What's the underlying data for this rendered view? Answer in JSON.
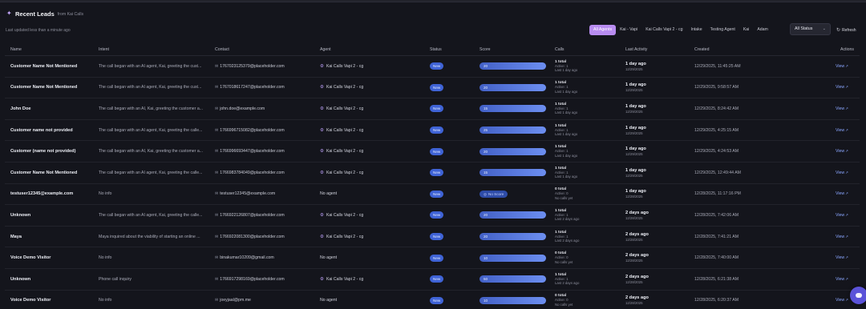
{
  "header": {
    "title": "Recent Leads",
    "subtitle": "from Kai Calls",
    "updated": "Last updated less than a minute ago"
  },
  "filters": {
    "agents": [
      "All Agents",
      "Kai - Vapi",
      "Kai Calls Vapi 2 - cg",
      "Intake",
      "Testing Agent",
      "Kai",
      "Adam"
    ],
    "active_agent_index": 0,
    "status_value": "All Status",
    "refresh_label": "Refresh"
  },
  "table": {
    "columns": [
      "Name",
      "Intent",
      "Contact",
      "Agent",
      "Status",
      "Score",
      "Calls",
      "Last Activity",
      "Created",
      "Actions"
    ],
    "rows": [
      {
        "name": "Customer Name Not Mentioned",
        "intent": "The call began with an AI agent, Kai, greeting the cust...",
        "contact": "1767023125379@placeholder.com",
        "agent": "Kai Calls Vapi 2 - cg",
        "has_agent": true,
        "status": "New",
        "score": "20",
        "score_text": "",
        "calls_total": "1 total",
        "calls_active": "Active: 1",
        "calls_last": "Last 1 day ago",
        "activity": "1 day ago",
        "activity_date": "12/29/2025",
        "created": "12/29/2025, 11:45:25 AM",
        "action": "View"
      },
      {
        "name": "Customer Name Not Mentioned",
        "intent": "The call began with an AI agent, Kai, greeting the cust...",
        "contact": "1767018617247@placeholder.com",
        "agent": "Kai Calls Vapi 2 - cg",
        "has_agent": true,
        "status": "New",
        "score": "20",
        "score_text": "",
        "calls_total": "1 total",
        "calls_active": "Active: 1",
        "calls_last": "Last 1 day ago",
        "activity": "1 day ago",
        "activity_date": "12/29/2025",
        "created": "12/29/2025, 9:58:57 AM",
        "action": "View"
      },
      {
        "name": "John Doe",
        "intent": "The call began with an AI, Kai, greeting the customer a...",
        "contact": "john.doe@example.com",
        "agent": "Kai Calls Vapi 2 - cg",
        "has_agent": true,
        "status": "New",
        "score": "15",
        "score_text": "",
        "calls_total": "1 total",
        "calls_active": "Active: 1",
        "calls_last": "Last 1 day ago",
        "activity": "1 day ago",
        "activity_date": "12/29/2025",
        "created": "12/29/2025, 8:24:42 AM",
        "action": "View"
      },
      {
        "name": "Customer name not provided",
        "intent": "The call began with an AI agent, Kai, greeting the calle...",
        "contact": "1766996715082@placeholder.com",
        "agent": "Kai Calls Vapi 2 - cg",
        "has_agent": true,
        "status": "New",
        "score": "25",
        "score_text": "",
        "calls_total": "1 total",
        "calls_active": "Active: 1",
        "calls_last": "Last 1 day ago",
        "activity": "1 day ago",
        "activity_date": "12/29/2025",
        "created": "12/29/2025, 4:25:15 AM",
        "action": "View"
      },
      {
        "name": "Customer (name not provided)",
        "intent": "The call began with an AI, Kai, greeting the customer a...",
        "contact": "1766996693447@placeholder.com",
        "agent": "Kai Calls Vapi 2 - cg",
        "has_agent": true,
        "status": "New",
        "score": "20",
        "score_text": "",
        "calls_total": "1 total",
        "calls_active": "Active: 1",
        "calls_last": "Last 1 day ago",
        "activity": "1 day ago",
        "activity_date": "12/29/2025",
        "created": "12/29/2025, 4:24:53 AM",
        "action": "View"
      },
      {
        "name": "Customer Name Not Mentioned",
        "intent": "The call began with an AI agent, Kai, greeting the calle...",
        "contact": "1766983784049@placeholder.com",
        "agent": "Kai Calls Vapi 2 - cg",
        "has_agent": true,
        "status": "New",
        "score": "15",
        "score_text": "",
        "calls_total": "1 total",
        "calls_active": "Active: 1",
        "calls_last": "Last 1 day ago",
        "activity": "1 day ago",
        "activity_date": "12/29/2025",
        "created": "12/29/2025, 12:49:44 AM",
        "action": "View"
      },
      {
        "name": "testuser12345@example.com",
        "intent": "No info",
        "contact": "testuser12345@example.com",
        "agent": "No agent",
        "has_agent": false,
        "status": "New",
        "score": "",
        "score_text": "No Score",
        "calls_total": "0 total",
        "calls_active": "Active: 0",
        "calls_last": "No calls yet",
        "activity": "1 day ago",
        "activity_date": "12/28/2025",
        "created": "12/28/2025, 11:17:16 PM",
        "action": "View"
      },
      {
        "name": "Unknown",
        "intent": "The call began with an AI agent, Kai, greeting the calle...",
        "contact": "1766922126807@placeholder.com",
        "agent": "Kai Calls Vapi 2 - cg",
        "has_agent": true,
        "status": "New",
        "score": "20",
        "score_text": "",
        "calls_total": "1 total",
        "calls_active": "Active: 1",
        "calls_last": "Last 2 days ago",
        "activity": "2 days ago",
        "activity_date": "12/28/2025",
        "created": "12/28/2025, 7:42:06 AM",
        "action": "View"
      },
      {
        "name": "Maya",
        "intent": "Maya inquired about the viability of starting an online ...",
        "contact": "1766922081300@placeholder.com",
        "agent": "Kai Calls Vapi 2 - cg",
        "has_agent": true,
        "status": "New",
        "score": "20",
        "score_text": "",
        "calls_total": "1 total",
        "calls_active": "Active: 1",
        "calls_last": "Last 2 days ago",
        "activity": "2 days ago",
        "activity_date": "12/28/2025",
        "created": "12/28/2025, 7:41:21 AM",
        "action": "View"
      },
      {
        "name": "Voice Demo Visitor",
        "intent": "No info",
        "contact": "binakumar10209@gmail.com",
        "agent": "No agent",
        "has_agent": false,
        "status": "New",
        "score": "10",
        "score_text": "",
        "calls_total": "0 total",
        "calls_active": "Active: 0",
        "calls_last": "No calls yet",
        "activity": "2 days ago",
        "activity_date": "12/28/2025",
        "created": "12/28/2025, 7:40:00 AM",
        "action": "View"
      },
      {
        "name": "Unknown",
        "intent": "Phone call inquiry",
        "contact": "1766917298169@placeholder.com",
        "agent": "Kai Calls Vapi 2 - cg",
        "has_agent": true,
        "status": "New",
        "score": "50",
        "score_text": "",
        "calls_total": "1 total",
        "calls_active": "Active: 1",
        "calls_last": "Last 2 days ago",
        "activity": "2 days ago",
        "activity_date": "12/28/2025",
        "created": "12/28/2025, 6:21:38 AM",
        "action": "View"
      },
      {
        "name": "Voice Demo Visitor",
        "intent": "No info",
        "contact": "joeyjaal@pm.me",
        "agent": "No agent",
        "has_agent": false,
        "status": "New",
        "score": "10",
        "score_text": "",
        "calls_total": "0 total",
        "calls_active": "Active: 0",
        "calls_last": "No calls yet",
        "activity": "2 days ago",
        "activity_date": "12/28/2025",
        "created": "12/28/2025, 6:20:37 AM",
        "action": "View"
      }
    ]
  }
}
